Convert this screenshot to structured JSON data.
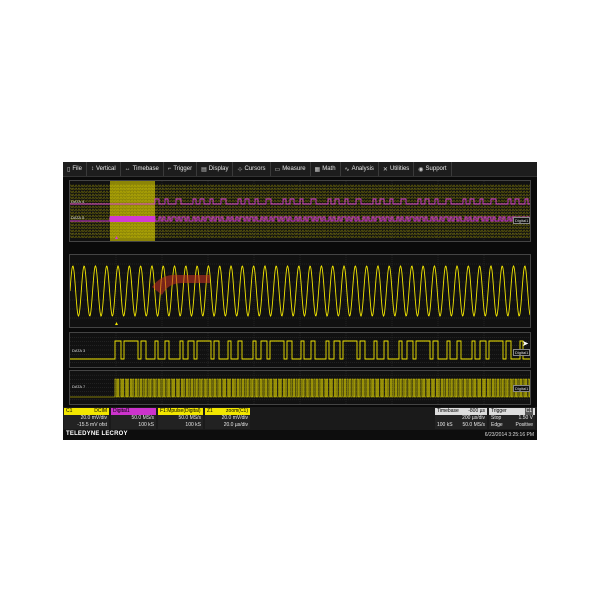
{
  "menu": [
    {
      "icon": "file-icon",
      "glyph": "▯",
      "label": "File"
    },
    {
      "icon": "vertical-icon",
      "glyph": "↕",
      "label": "Vertical"
    },
    {
      "icon": "timebase-icon",
      "glyph": "↔",
      "label": "Timebase"
    },
    {
      "icon": "trigger-icon",
      "glyph": "⌐",
      "label": "Trigger"
    },
    {
      "icon": "display-icon",
      "glyph": "▤",
      "label": "Display"
    },
    {
      "icon": "cursors-icon",
      "glyph": "⊹",
      "label": "Cursors"
    },
    {
      "icon": "measure-icon",
      "glyph": "▭",
      "label": "Measure"
    },
    {
      "icon": "math-icon",
      "glyph": "▦",
      "label": "Math"
    },
    {
      "icon": "analysis-icon",
      "glyph": "∿",
      "label": "Analysis"
    },
    {
      "icon": "utilities-icon",
      "glyph": "✕",
      "label": "Utilities"
    },
    {
      "icon": "support-icon",
      "glyph": "◉",
      "label": "Support"
    }
  ],
  "digital_labels": {
    "d4": "DATA 4",
    "d5": "DATA 5",
    "tag_top": "Digital1"
  },
  "data3": {
    "label": "DATA 3",
    "tag": "Digital1"
  },
  "data7": {
    "label": "DATA 7",
    "tag": "Digital1"
  },
  "channels": [
    {
      "name": "C1",
      "badge": "DCIM",
      "color": "#f2e600",
      "rows": [
        "20.0 mV/div",
        "-15.5 mV ofst"
      ]
    },
    {
      "name": "Digital1",
      "badge": "",
      "color": "#cc33cc",
      "rows": [
        "50.0 MS/s",
        "100 kS"
      ]
    },
    {
      "name": "F1:Mpulse(Digital)",
      "badge": "",
      "color": "#f2e600",
      "rows": [
        "50.0 MS/s",
        "100 kS"
      ]
    },
    {
      "name": "Z1",
      "badge": "zoom(C1)",
      "color": "#f2e600",
      "rows": [
        "20.0 mV/div",
        "20.0 µs/div"
      ]
    }
  ],
  "timebase": {
    "title": "Timebase",
    "value": "-800 µs",
    "rows": [
      [
        "",
        "200 µs/div"
      ],
      [
        "100 kS",
        "50.0 MS/s"
      ]
    ]
  },
  "trigger": {
    "title": "Trigger",
    "badge": "C1",
    "rows": [
      [
        "Stop",
        "1.50 V"
      ],
      [
        "Edge",
        "Positive"
      ]
    ]
  },
  "brand": {
    "name": "TELEDYNE LECROY"
  },
  "timestamp": "6/23/2014 3:25:16 PM",
  "colors": {
    "yellow": "#f2e600",
    "magenta": "#d23bd2"
  }
}
